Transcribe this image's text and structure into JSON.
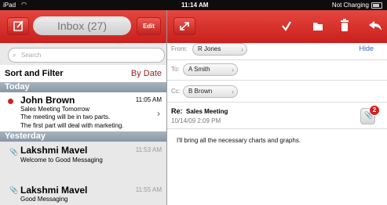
{
  "status": {
    "carrier": "iPad",
    "time": "11:14 AM",
    "charging": "Not Charging"
  },
  "left": {
    "compose_icon": "compose-icon",
    "inbox_label": "Inbox (27)",
    "edit_label": "Edit",
    "search_placeholder": "Search",
    "sort_label": "Sort and Filter",
    "sort_value": "By Date",
    "sections": [
      "Today",
      "Yesterday"
    ],
    "messages": [
      {
        "sender": "John Brown",
        "time": "11:05 AM",
        "subject": "Sales Meeting Tomorrow",
        "preview1": "The meeting will be in two parts.",
        "preview2": "The first part will deal with marketing.",
        "unread": true
      },
      {
        "sender": "Lakshmi Mavel",
        "time": "11:53 AM",
        "subject": "Welcome to Good Messaging"
      },
      {
        "sender": "Lakshmi Mavel",
        "time": "11:55 AM",
        "subject": "Good Messaging"
      }
    ]
  },
  "right": {
    "from_label": "From:",
    "from_value": "R Jones",
    "hide_label": "Hide",
    "to_label": "To:",
    "to_value": "A Smith",
    "cc_label": "Cc:",
    "cc_value": "B Brown",
    "subject_prefix": "Re:",
    "subject": "Sales Meeting",
    "date": "10/14/09 2:09 PM",
    "attachment_count": "2",
    "body": "I'll bring all the necessary charts and graphs."
  },
  "colors": {
    "header_red": "#d8322c",
    "section_gray": "#96a4b2",
    "link_blue": "#3a66c4",
    "unread_red": "#d42020"
  }
}
